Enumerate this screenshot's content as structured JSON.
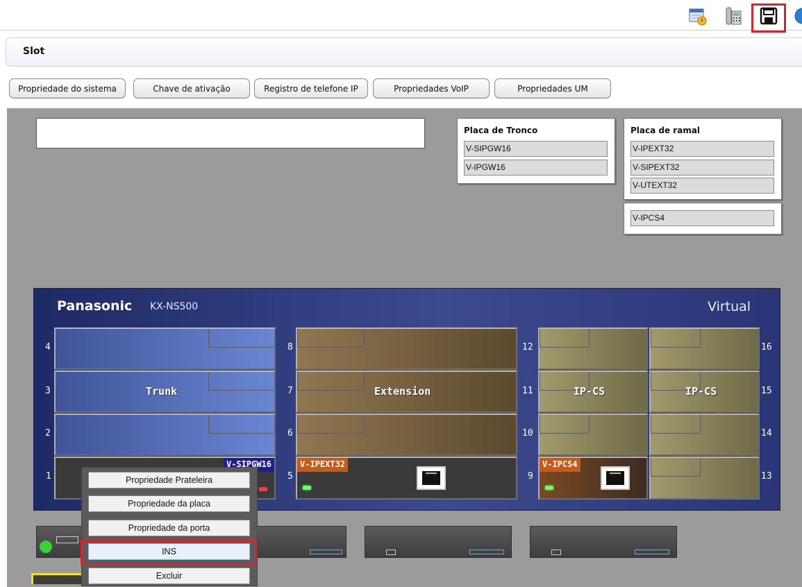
{
  "toolbar": {
    "icons": [
      "calendar-alarm-icon",
      "phone-icon",
      "save-icon",
      "globe-icon"
    ]
  },
  "header": {
    "title": "Slot"
  },
  "tabs": [
    "Propriedade do sistema",
    "Chave de ativação",
    "Registro de telefone IP",
    "Propriedades VoIP",
    "Propriedades UM"
  ],
  "trunk_panel": {
    "title": "Placa de Tronco",
    "items": [
      "V-SIPGW16",
      "V-IPGW16"
    ]
  },
  "extension_panel": {
    "title": "Placa de ramal",
    "items": [
      "V-IPEXT32",
      "V-SIPEXT32",
      "V-UTEXT32"
    ]
  },
  "cs_panel": {
    "items": [
      "V-IPCS4"
    ]
  },
  "chassis": {
    "brand": "Panasonic",
    "model": "KX-NS500",
    "type": "Virtual",
    "groups": [
      "Trunk",
      "Extension",
      "IP-CS",
      "IP-CS"
    ],
    "slot_numbers": [
      "4",
      "3",
      "2",
      "1",
      "8",
      "7",
      "6",
      "5",
      "12",
      "11",
      "10",
      "9",
      "16",
      "15",
      "14",
      "13"
    ],
    "installed_cards": {
      "slot1": "V-SIPGW16",
      "slot5": "V-IPEXT32",
      "slot9": "V-IPCS4"
    }
  },
  "context_menu": {
    "items": [
      "Propriedade Prateleira",
      "Propriedade da placa",
      "Propriedade da porta",
      "INS",
      "Excluir"
    ],
    "highlighted": "INS"
  },
  "colors": {
    "highlight": "#d9242d",
    "chassis": "#2a3576",
    "card_tag": "#c65a16"
  }
}
